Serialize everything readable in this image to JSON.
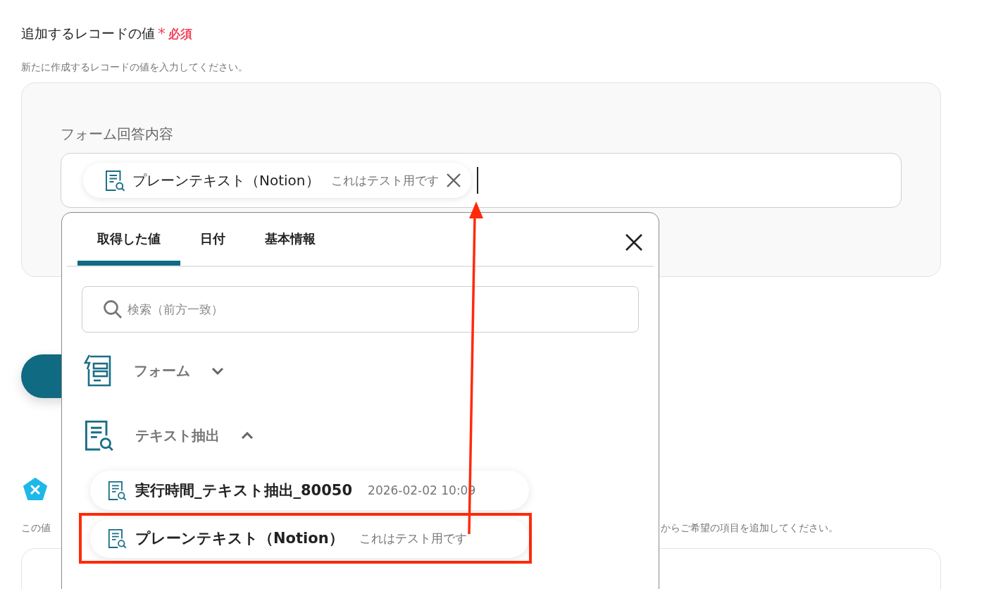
{
  "field": {
    "title": "追加するレコードの値",
    "required_mark": "*",
    "required_label": "必須",
    "description": "新たに作成するレコードの値を入力してください。",
    "input_label": "フォーム回答内容",
    "token": {
      "name": "プレーンテキスト（Notion）",
      "value": "これはテスト用です"
    }
  },
  "picker": {
    "tabs": [
      {
        "label": "取得した値",
        "selected": true
      },
      {
        "label": "日付",
        "selected": false
      },
      {
        "label": "基本情報",
        "selected": false
      }
    ],
    "search": {
      "placeholder": "検索（前方一致）"
    },
    "groups": [
      {
        "kind": "form",
        "label": "フォーム",
        "expanded": false
      },
      {
        "kind": "text",
        "label": "テキスト抽出",
        "expanded": true,
        "items": [
          {
            "name": "実行時間_テキスト抽出_80050",
            "value": "2026-02-02 10:09",
            "highlighted": false
          },
          {
            "name": "プレーンテキスト（Notion）",
            "value": "これはテスト用です",
            "highlighted": true
          }
        ]
      }
    ]
  },
  "background": {
    "description_start": "この値",
    "description_end": "からご希望の項目を追加してください。"
  }
}
